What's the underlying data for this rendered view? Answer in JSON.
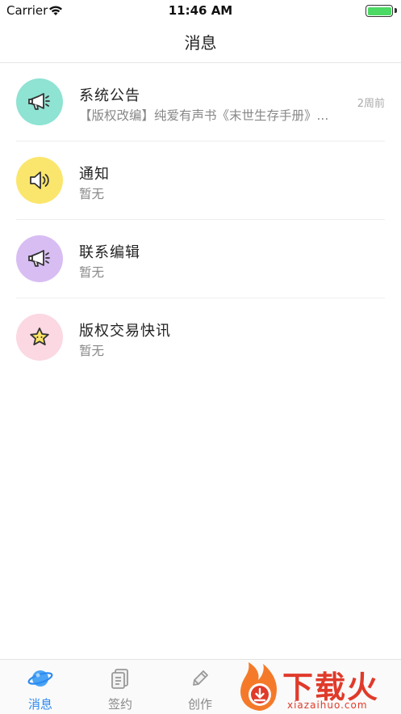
{
  "status_bar": {
    "carrier": "Carrier",
    "time": "11:46 AM",
    "battery_level": 1.0
  },
  "nav": {
    "title": "消息"
  },
  "messages": [
    {
      "title": "系统公告",
      "preview": "【版权改编】纯爱有声书《末世生存手册》...",
      "time": "2周前",
      "icon": "megaphone-icon",
      "color": "#8ee3d3"
    },
    {
      "title": "通知",
      "preview": "暂无",
      "time": "",
      "icon": "speaker-icon",
      "color": "#fbe66d"
    },
    {
      "title": "联系编辑",
      "preview": "暂无",
      "time": "",
      "icon": "megaphone-icon",
      "color": "#d8bdf3"
    },
    {
      "title": "版权交易快讯",
      "preview": "暂无",
      "time": "",
      "icon": "star-icon",
      "color": "#fbd8e2"
    }
  ],
  "tabs": [
    {
      "label": "消息",
      "icon": "planet-icon",
      "active": true
    },
    {
      "label": "签约",
      "icon": "document-icon",
      "active": false
    },
    {
      "label": "创作",
      "icon": "pencil-icon",
      "active": false
    }
  ],
  "watermark": {
    "text": "下载火",
    "sub": "xiazaihuo.com"
  }
}
